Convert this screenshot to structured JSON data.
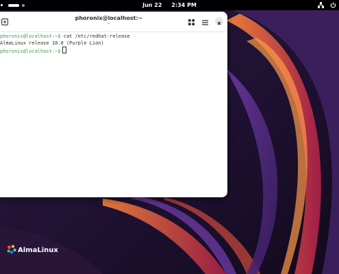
{
  "topbar": {
    "date": "Jun 22",
    "time": "2:34 PM"
  },
  "terminal": {
    "title": "phoronix@localhost:~",
    "title_sub": "—",
    "lines": [
      {
        "prompt": "phoronix@localhost:~$",
        "command": " cat /etc/redhat-release"
      },
      {
        "output": "AlmaLinux release 10.0 (Purple Lion)"
      },
      {
        "prompt": "phoronix@localhost:~$",
        "command": " "
      }
    ]
  },
  "desktop": {
    "logo_text": "AlmaLinux"
  },
  "icons": {
    "new_tab": "new-tab-icon",
    "view": "grid-icon",
    "menu": "hamburger-menu-icon",
    "close": "close-icon",
    "network": "network-icon",
    "power": "power-icon"
  },
  "colors": {
    "prompt": "#3a9a46",
    "topbar": "#000000",
    "wallpaper_base": "#1a1026",
    "accent_orange": "#e06a2a"
  }
}
